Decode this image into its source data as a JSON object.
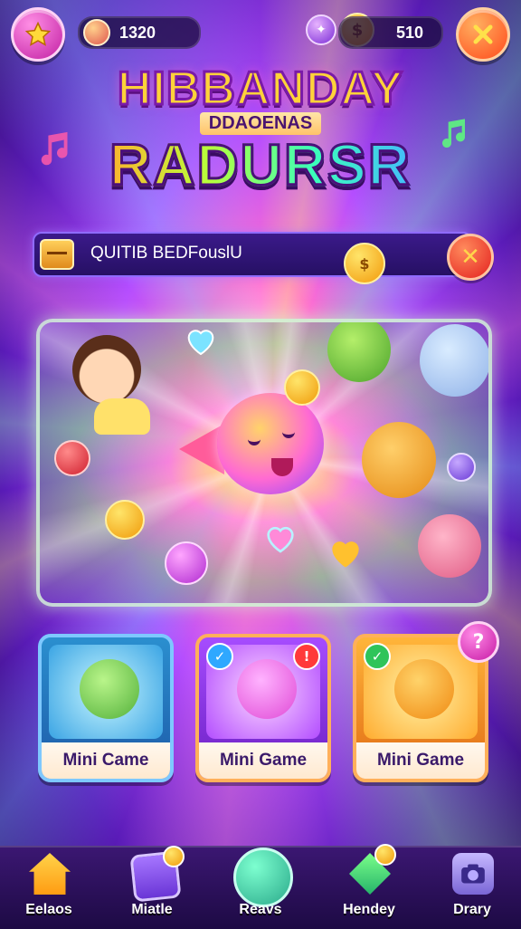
{
  "header": {
    "left_currency": "1320",
    "right_currency": "510",
    "coin_symbol": "$"
  },
  "title": {
    "line1": "HIBBANDAY",
    "sub": "DDAOENAS",
    "line2": "RADURSR"
  },
  "name_bar": {
    "text": "QUITIB BEDFouslU",
    "close_symbol": "✕",
    "coin_symbol": "$"
  },
  "cards": [
    {
      "label": "Mini Came"
    },
    {
      "label": "Mini Game"
    },
    {
      "label": "Mini Game"
    }
  ],
  "badge_q": "?",
  "nav": {
    "items": [
      {
        "label": "Eelaos",
        "icon": "home-icon"
      },
      {
        "label": "Miatle",
        "icon": "match-icon"
      },
      {
        "label": "Reavs",
        "icon": "reward-icon"
      },
      {
        "label": "Hendey",
        "icon": "gem-icon"
      },
      {
        "label": "Drary",
        "icon": "camera-icon"
      }
    ]
  },
  "colors": {
    "accent_pink": "#c21fa3",
    "accent_orange": "#ff4a1c",
    "nav_bg": "#1d0a44",
    "gold": "#f09a0a"
  }
}
